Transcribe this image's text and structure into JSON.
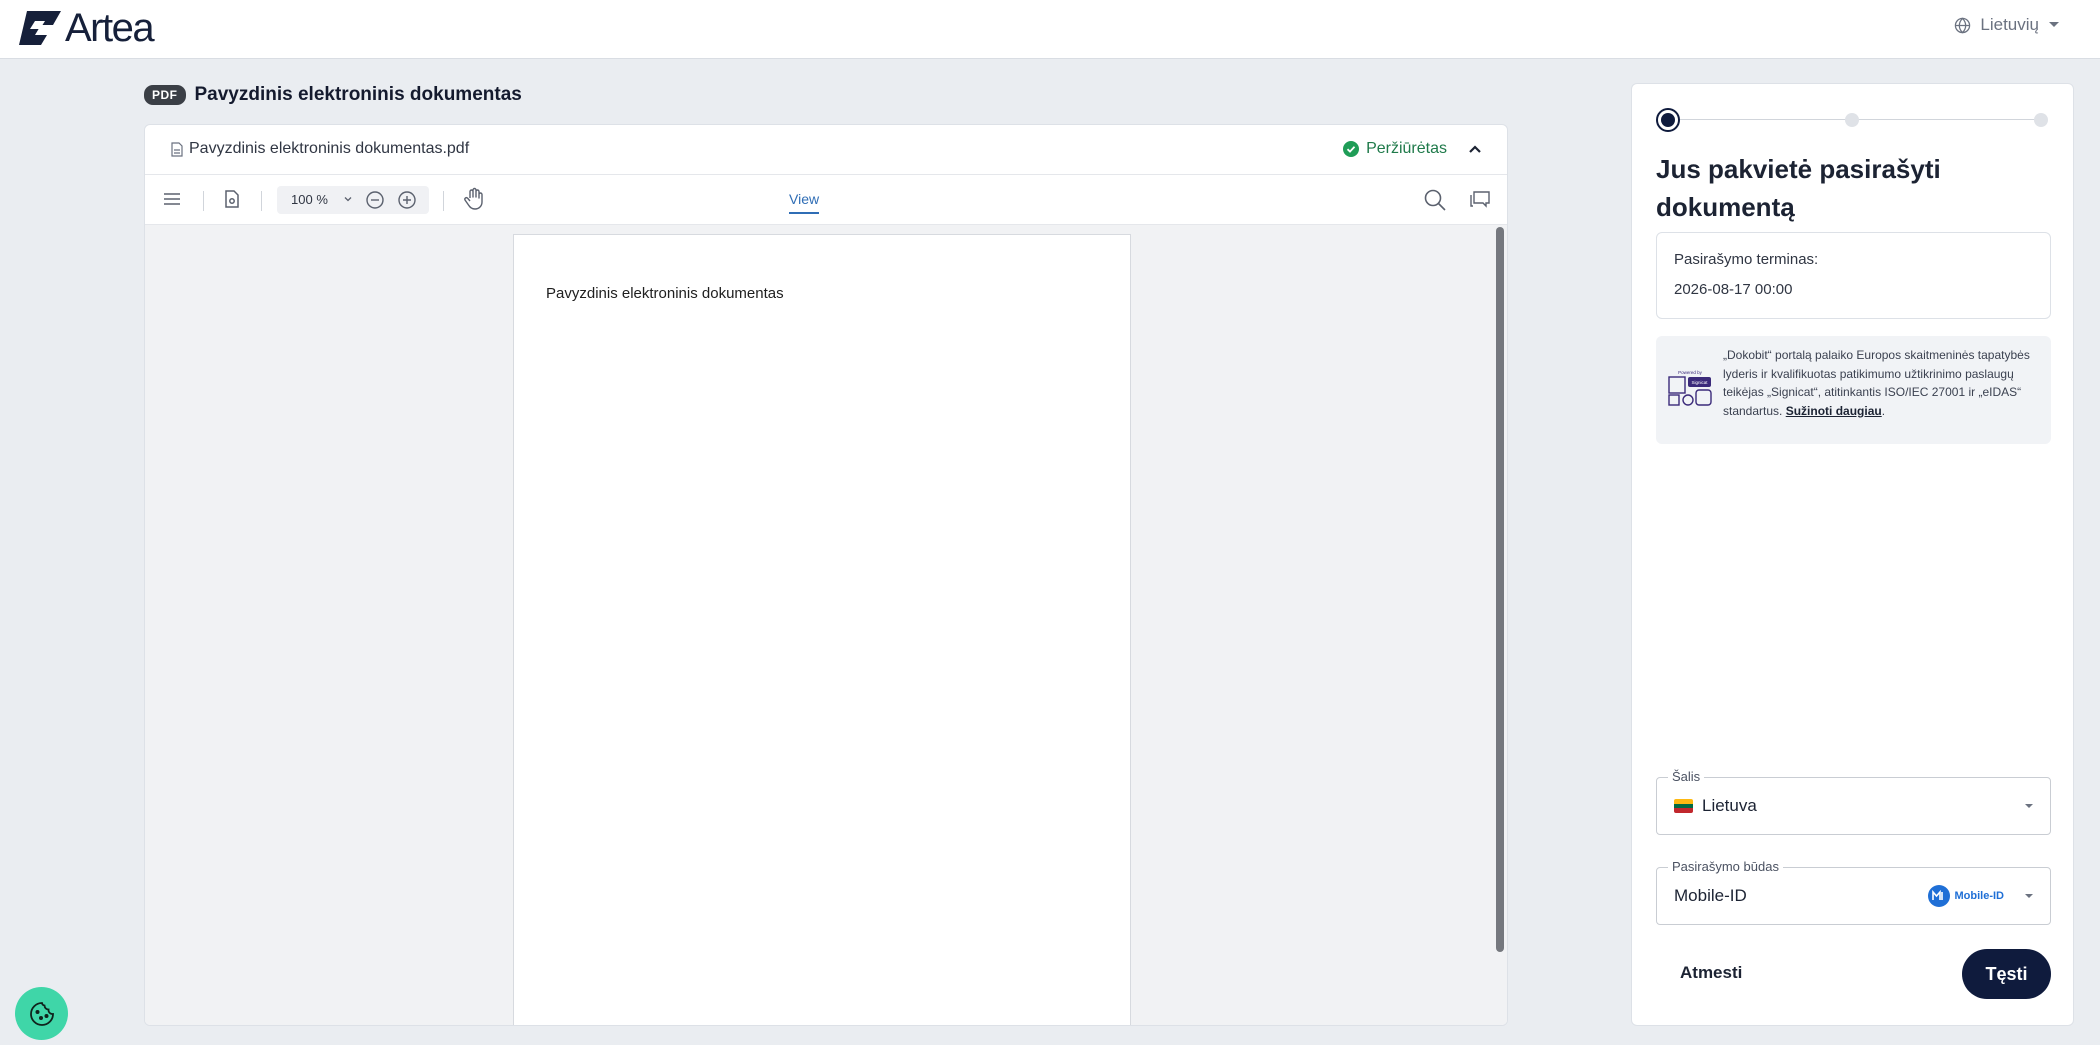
{
  "brand": {
    "name": "Artea"
  },
  "language": {
    "label": "Lietuvių"
  },
  "document": {
    "badge": "PDF",
    "title": "Pavyzdinis elektroninis dokumentas",
    "file_name": "Pavyzdinis elektroninis dokumentas.pdf",
    "status": "Peržiūrėtas",
    "page_text": "Pavyzdinis elektroninis dokumentas"
  },
  "toolbar": {
    "zoom_value": "100",
    "zoom_unit": "%",
    "view_tab": "View"
  },
  "panel": {
    "steps_total": 3,
    "current_step": 1,
    "title": "Jus pakvietė pasirašyti dokumentą",
    "deadline_label": "Pasirašymo terminas:",
    "deadline_value": "2026-08-17 00:00",
    "info_text": "„Dokobit“ portalą palaiko Europos skaitmeninės tapatybės lyderis ir kvalifikuotas patikimumo užtikrinimo paslaugų teikėjas „Signicat“, atitinkantis ISO/IEC 27001 ir „eIDAS“ standartus.",
    "info_link": "Sužinoti daugiau",
    "info_end": ".",
    "info_logo_caption": "Powered by",
    "info_logo_brand": "Signicat",
    "country_label": "Šalis",
    "country_value": "Lietuva",
    "method_label": "Pasirašymo būdas",
    "method_value": "Mobile-ID",
    "method_logo_text": "Mobile-ID",
    "reject_label": "Atmesti",
    "continue_label": "Tęsti"
  },
  "colors": {
    "primary": "#0f1b3d",
    "success": "#1f9d57",
    "link": "#2f6db5",
    "cookie": "#3fd6a8"
  }
}
